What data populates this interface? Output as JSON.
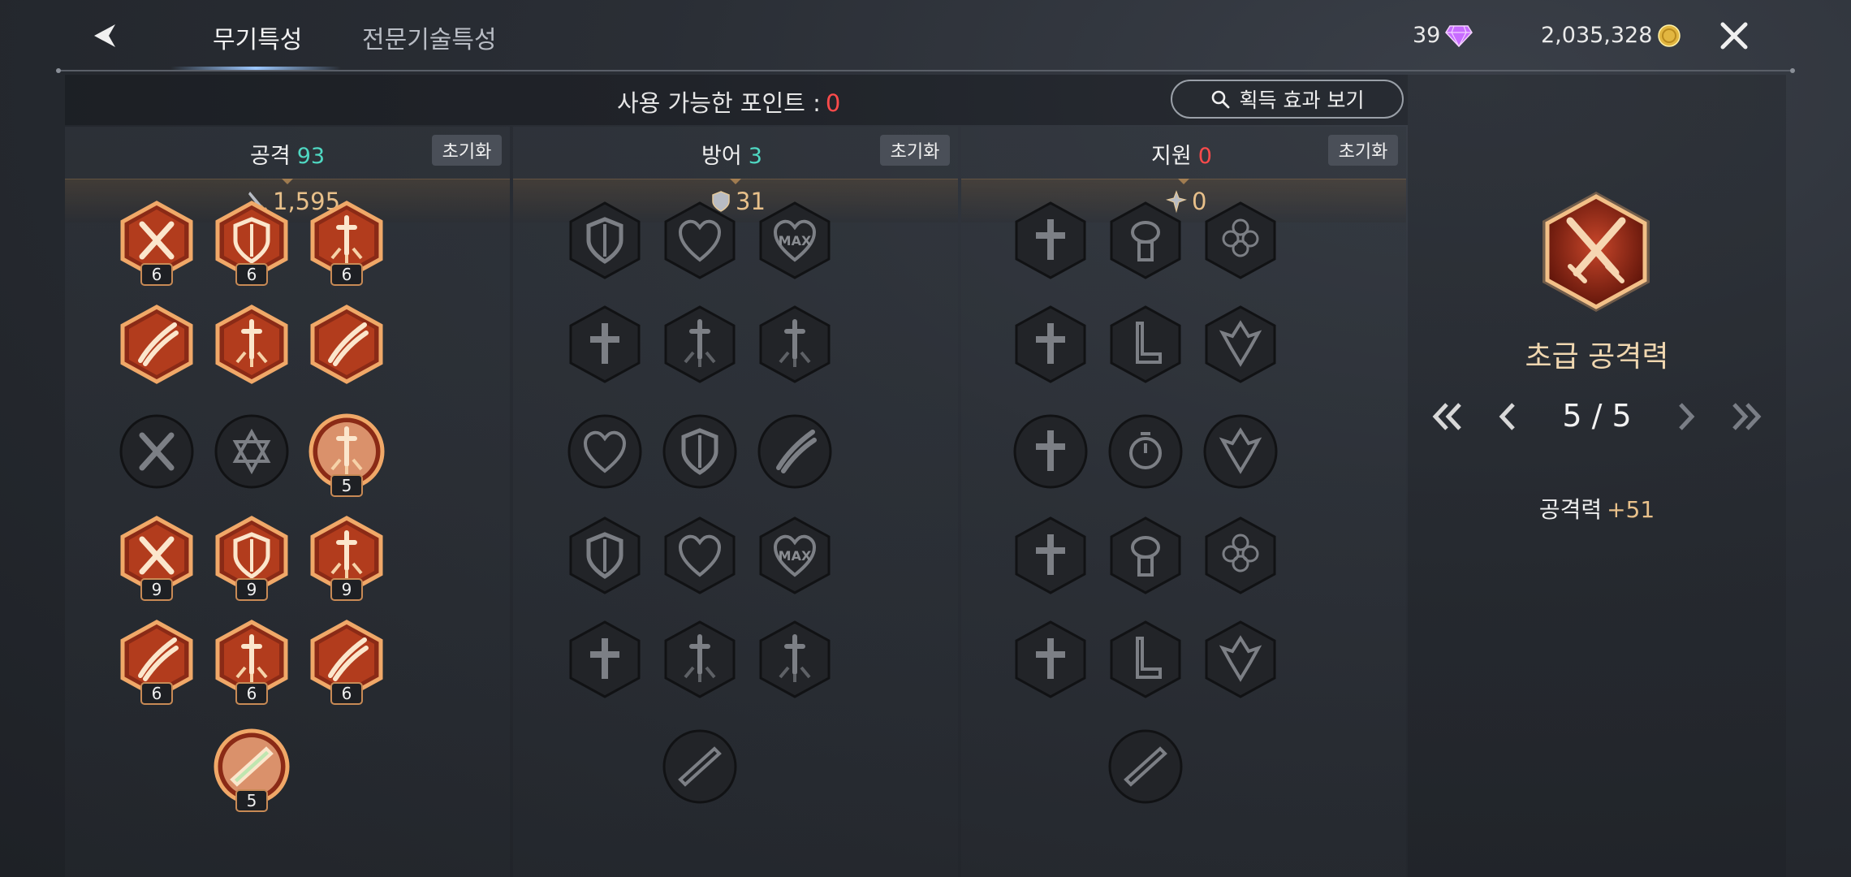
{
  "header": {
    "tabs": [
      {
        "label": "무기특성",
        "active": true
      },
      {
        "label": "전문기술특성",
        "active": false
      }
    ],
    "gems": "39",
    "gold": "2,035,328"
  },
  "points": {
    "label": "사용 가능한 포인트 :",
    "value": "0"
  },
  "effect_button": {
    "label": "획득 효과 보기"
  },
  "columns": [
    {
      "title": "공격",
      "count": "93",
      "count_color": "#4fd8c2",
      "reset": "초기화",
      "stat": "1,595",
      "stat_icon": "sword-icon"
    },
    {
      "title": "방어",
      "count": "3",
      "count_color": "#4fd8c2",
      "reset": "초기화",
      "stat": "31",
      "stat_icon": "shield-icon"
    },
    {
      "title": "지원",
      "count": "0",
      "count_color": "#ff4b4b",
      "reset": "초기화",
      "stat": "0",
      "stat_icon": "support-icon"
    }
  ],
  "attack_nodes": [
    {
      "shape": "hex",
      "icon": "crossed-swords-icon",
      "active": true,
      "level": "6"
    },
    {
      "shape": "hex",
      "icon": "sword-shield-icon",
      "active": true,
      "level": "6"
    },
    {
      "shape": "hex",
      "icon": "sword-burst-icon",
      "active": true,
      "level": "6"
    },
    {
      "shape": "hex",
      "icon": "slash-sword-icon",
      "active": true,
      "level": ""
    },
    {
      "shape": "hex",
      "icon": "sparkle-sword-icon",
      "active": true,
      "level": ""
    },
    {
      "shape": "hex",
      "icon": "claw-slash-icon",
      "active": true,
      "level": ""
    },
    {
      "shape": "circle",
      "icon": "crossed-swords-icon",
      "active": false,
      "level": ""
    },
    {
      "shape": "circle",
      "icon": "hexagram-icon",
      "active": false,
      "level": ""
    },
    {
      "shape": "circle",
      "icon": "sword-burst-icon",
      "active": true,
      "level": "5"
    },
    {
      "shape": "hex",
      "icon": "crossed-swords-icon",
      "active": true,
      "level": "9"
    },
    {
      "shape": "hex",
      "icon": "sword-shield-icon",
      "active": true,
      "level": "9"
    },
    {
      "shape": "hex",
      "icon": "sword-burst-icon",
      "active": true,
      "level": "9"
    },
    {
      "shape": "hex",
      "icon": "slash-sword-icon",
      "active": true,
      "level": "6"
    },
    {
      "shape": "hex",
      "icon": "sparkle-sword-icon",
      "active": true,
      "level": "6"
    },
    {
      "shape": "hex",
      "icon": "claw-slash-icon",
      "active": true,
      "level": "6"
    },
    {
      "shape": "circle",
      "icon": "green-blade-icon",
      "active": true,
      "level": "5"
    }
  ],
  "defense_nodes": [
    {
      "shape": "hex",
      "icon": "shield-sword-icon"
    },
    {
      "shape": "hex",
      "icon": "heart-cross-icon"
    },
    {
      "shape": "hex",
      "icon": "max-heart-icon",
      "text": "MAX"
    },
    {
      "shape": "hex",
      "icon": "holy-cross-icon"
    },
    {
      "shape": "hex",
      "icon": "sword-burst-icon"
    },
    {
      "shape": "hex",
      "icon": "anchor-sword-icon"
    },
    {
      "shape": "circle",
      "icon": "broken-heart-icon"
    },
    {
      "shape": "circle",
      "icon": "shield-icon"
    },
    {
      "shape": "circle",
      "icon": "arrow-deflect-icon"
    },
    {
      "shape": "hex",
      "icon": "shield-sword-icon"
    },
    {
      "shape": "hex",
      "icon": "heart-cross-icon"
    },
    {
      "shape": "hex",
      "icon": "max-heart-icon",
      "text": "MAX"
    },
    {
      "shape": "hex",
      "icon": "holy-cross-icon"
    },
    {
      "shape": "hex",
      "icon": "sword-burst-icon"
    },
    {
      "shape": "hex",
      "icon": "anchor-sword-icon"
    },
    {
      "shape": "circle",
      "icon": "dark-blade-icon"
    }
  ],
  "support_nodes": [
    {
      "shape": "hex",
      "icon": "holy-cross-icon"
    },
    {
      "shape": "hex",
      "icon": "herb-icon"
    },
    {
      "shape": "hex",
      "icon": "clover-icon"
    },
    {
      "shape": "hex",
      "icon": "winged-cross-icon"
    },
    {
      "shape": "hex",
      "icon": "winged-boot-icon"
    },
    {
      "shape": "hex",
      "icon": "dragon-icon"
    },
    {
      "shape": "circle",
      "icon": "radiant-cross-icon"
    },
    {
      "shape": "circle",
      "icon": "stopwatch-icon"
    },
    {
      "shape": "circle",
      "icon": "compass-dragon-icon"
    },
    {
      "shape": "hex",
      "icon": "holy-cross-icon"
    },
    {
      "shape": "hex",
      "icon": "herb-icon"
    },
    {
      "shape": "hex",
      "icon": "clover-icon"
    },
    {
      "shape": "hex",
      "icon": "winged-cross-icon"
    },
    {
      "shape": "hex",
      "icon": "winged-boot-icon"
    },
    {
      "shape": "hex",
      "icon": "dragon-icon"
    },
    {
      "shape": "circle",
      "icon": "dark-blade-icon"
    }
  ],
  "detail": {
    "name": "초급 공격력",
    "page": "5 / 5",
    "effect_label": "공격력",
    "effect_value": "+51"
  },
  "colors": {
    "accent_active": "#e98a4a",
    "inactive": "#3a3d42",
    "cyan": "#4fd8c2",
    "red": "#ff4b4b",
    "gold": "#e8c08a"
  }
}
